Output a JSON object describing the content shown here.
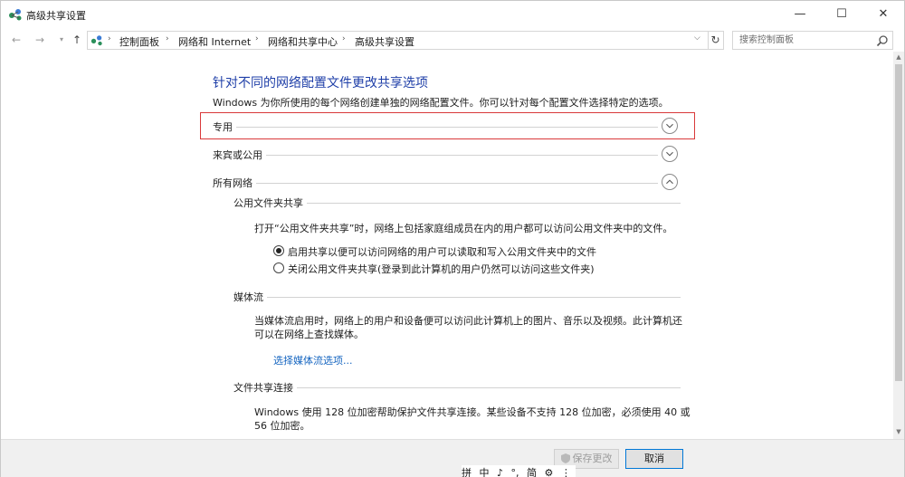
{
  "window": {
    "title": "高级共享设置",
    "controls": {
      "minimize": "—",
      "maximize": "☐",
      "close": "✕"
    }
  },
  "address": {
    "crumbs": [
      "控制面板",
      "网络和 Internet",
      "网络和共享中心",
      "高级共享设置"
    ],
    "separator": "›",
    "search_placeholder": "搜索控制面板"
  },
  "main": {
    "heading": "针对不同的网络配置文件更改共享选项",
    "description": "Windows 为你所使用的每个网络创建单独的网络配置文件。你可以针对每个配置文件选择特定的选项。",
    "profiles": [
      {
        "label": "专用",
        "expanded": false
      },
      {
        "label": "来宾或公用",
        "expanded": false
      },
      {
        "label": "所有网络",
        "expanded": true
      }
    ],
    "public_folder": {
      "title": "公用文件夹共享",
      "description": "打开“公用文件夹共享”时，网络上包括家庭组成员在内的用户都可以访问公用文件夹中的文件。",
      "options": [
        {
          "label": "启用共享以便可以访问网络的用户可以读取和写入公用文件夹中的文件",
          "checked": true
        },
        {
          "label": "关闭公用文件夹共享(登录到此计算机的用户仍然可以访问这些文件夹)",
          "checked": false
        }
      ]
    },
    "media": {
      "title": "媒体流",
      "description_line1": "当媒体流启用时，网络上的用户和设备便可以访问此计算机上的图片、音乐以及视频。此计算机还",
      "description_line2": "可以在网络上查找媒体。",
      "link": "选择媒体流选项..."
    },
    "file_sharing": {
      "title": "文件共享连接",
      "description_line1": "Windows 使用 128 位加密帮助保护文件共享连接。某些设备不支持 128 位加密，必须使用 40 或",
      "description_line2": "56 位加密。"
    }
  },
  "footer": {
    "save_label": "保存更改",
    "cancel_label": "取消"
  },
  "ime": {
    "items": [
      "拼",
      "中",
      "♪",
      "°,",
      "简",
      "⚙",
      "⋮"
    ]
  },
  "colors": {
    "heading": "#1f3fa8",
    "link": "#1565c0",
    "highlight_border": "#d9393a",
    "footer_bg": "#f0f0f0"
  }
}
